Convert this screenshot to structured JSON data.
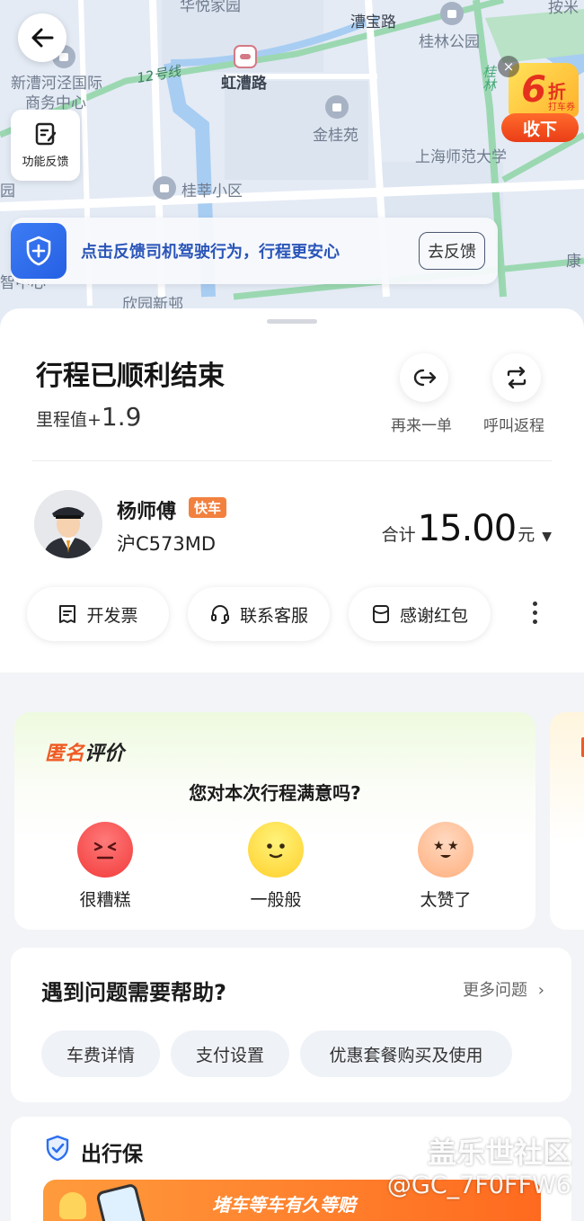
{
  "map": {
    "labels": {
      "huayue": "华悦家园",
      "caobaolu": "漕宝路",
      "guilin_park": "桂林公园",
      "xincao": "新漕河泾国际",
      "business": "商务中心",
      "line12": "12号线",
      "hongcaolu": "虹漕路",
      "guilin_v": "桂林",
      "jinguiyuan": "金桂苑",
      "normal_univ": "上海师范大学",
      "guixin": "桂莘小区",
      "yuan": "园",
      "kang": "康",
      "zhizhongxin": "智中心",
      "xinyuan": "欣园新邨",
      "top_right": "按米"
    },
    "feedback_label": "功能反馈",
    "promo": {
      "number": "6",
      "unit": "折",
      "sub": "打车券",
      "action": "收下",
      "close": "×"
    },
    "safety": {
      "text": "点击反馈司机驾驶行为，行程更安心",
      "button": "去反馈"
    }
  },
  "trip": {
    "title": "行程已顺利结束",
    "mileage_label": "里程值+",
    "mileage_value": "1.9",
    "actions": {
      "again": "再来一单",
      "return": "呼叫返程"
    },
    "driver": {
      "name": "杨师傅",
      "type": "快车",
      "plate": "沪C573MD"
    },
    "fare": {
      "label": "合计",
      "amount": "15.00",
      "unit": "元"
    },
    "buttons": {
      "invoice": "开发票",
      "service": "联系客服",
      "tip": "感谢红包"
    }
  },
  "rating": {
    "tag_prefix": "匿名",
    "tag_suffix": "评价",
    "question": "您对本次行程满意吗?",
    "options": {
      "bad": "很糟糕",
      "ok": "一般般",
      "great": "太赞了"
    }
  },
  "help": {
    "title": "遇到问题需要帮助?",
    "more": "更多问题",
    "chips": {
      "fare": "车费详情",
      "pay": "支付设置",
      "package": "优惠套餐购买及使用"
    }
  },
  "insurance": {
    "title": "出行保",
    "banner": "堵车等车有久等赔"
  },
  "watermark": {
    "site": "盖乐世社区",
    "user": "@GC_7F0FFW6"
  },
  "colors": {
    "accent_orange": "#f05a24",
    "safety_blue": "#2a55b8",
    "promo_red": "#e5301e",
    "tag_orange": "#f2813f"
  }
}
